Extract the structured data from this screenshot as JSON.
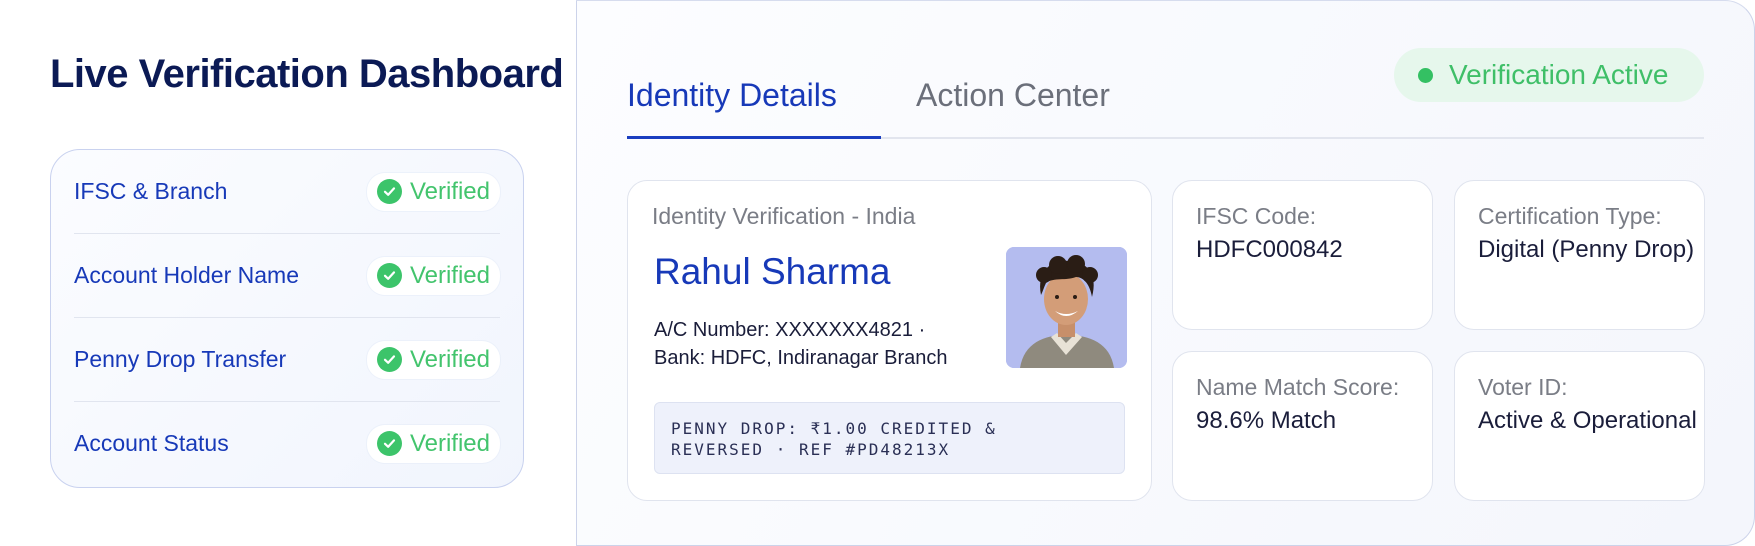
{
  "page_title": "Live Verification Dashboard",
  "checklist": [
    {
      "label": "IFSC & Branch",
      "status": "Verified"
    },
    {
      "label": "Account Holder Name",
      "status": "Verified"
    },
    {
      "label": "Penny Drop Transfer",
      "status": "Verified"
    },
    {
      "label": "Account Status",
      "status": "Verified"
    }
  ],
  "tabs": {
    "identity": "Identity Details",
    "action": "Action Center",
    "active": "identity"
  },
  "status_badge": "Verification Active",
  "identity_card": {
    "caption": "Identity Verification - India",
    "name": "Rahul Sharma",
    "account": "A/C Number: XXXXXXX4821 ·",
    "bank": "Bank: HDFC, Indiranagar Branch",
    "penny_line1": "PENNY DROP: ₹1.00 CREDITED &",
    "penny_line2": "REVERSED · REF #PD48213X"
  },
  "info_cards": {
    "ifsc": {
      "label": "IFSC Code:",
      "value": "HDFC000842"
    },
    "cert": {
      "label": "Certification Type:",
      "value": "Digital (Penny Drop)"
    },
    "score": {
      "label": "Name Match Score:",
      "value": "98.6% Match"
    },
    "voter": {
      "label": "Voter ID:",
      "value": "Active & Operational"
    }
  },
  "colors": {
    "brand_blue": "#1739b8",
    "success_green": "#3cc46a",
    "status_pill_bg": "#e6f7ec"
  },
  "icons": [
    "check-circle-icon",
    "status-dot-icon",
    "profile-photo"
  ]
}
